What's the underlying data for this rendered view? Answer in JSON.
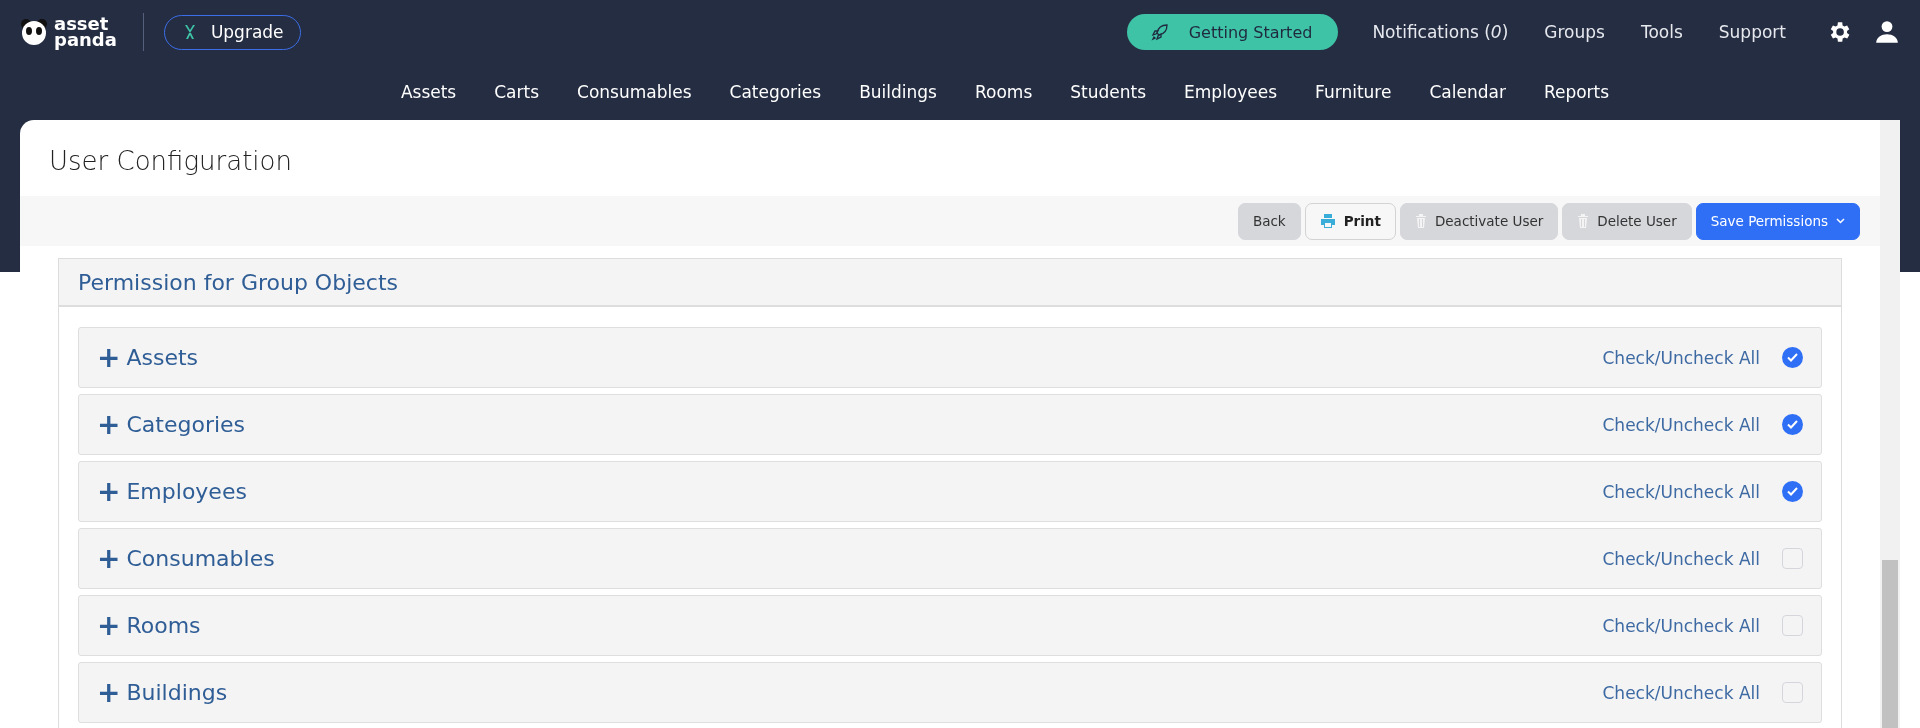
{
  "brand": {
    "line_1": "asset",
    "line_2": "panda"
  },
  "upgrade_button": "Upgrade",
  "top_links": [
    {
      "kind": "pill",
      "label": "Getting Started"
    },
    {
      "kind": "notifications",
      "label": "Notifications (",
      "count": "0",
      "tail": ")"
    },
    {
      "kind": "link",
      "label": "Groups"
    },
    {
      "kind": "link",
      "label": "Tools"
    },
    {
      "kind": "link",
      "label": "Support"
    }
  ],
  "nav": [
    "Assets",
    "Carts",
    "Consumables",
    "Categories",
    "Buildings",
    "Rooms",
    "Students",
    "Employees",
    "Furniture",
    "Calendar",
    "Reports"
  ],
  "page_title": "User Configuration",
  "actions": [
    {
      "kind": "plain",
      "label": "Back"
    },
    {
      "kind": "print",
      "label": "Print"
    },
    {
      "kind": "trash",
      "label": "Deactivate User"
    },
    {
      "kind": "trash",
      "label": "Delete User"
    },
    {
      "kind": "primary",
      "label": "Save Permissions"
    }
  ],
  "panel": {
    "title": "Permission for Group Objects",
    "groups": [
      {
        "icon": "+",
        "name": "Assets",
        "toggle_label": "Check/Uncheck All",
        "checked": true
      },
      {
        "icon": "+",
        "name": "Categories",
        "toggle_label": "Check/Uncheck All",
        "checked": true
      },
      {
        "icon": "+",
        "name": "Employees",
        "toggle_label": "Check/Uncheck All",
        "checked": true
      },
      {
        "icon": "+",
        "name": "Consumables",
        "toggle_label": "Check/Uncheck All",
        "checked": false
      },
      {
        "icon": "+",
        "name": "Rooms",
        "toggle_label": "Check/Uncheck All",
        "checked": false
      },
      {
        "icon": "+",
        "name": "Buildings",
        "toggle_label": "Check/Uncheck All",
        "checked": false
      }
    ]
  }
}
